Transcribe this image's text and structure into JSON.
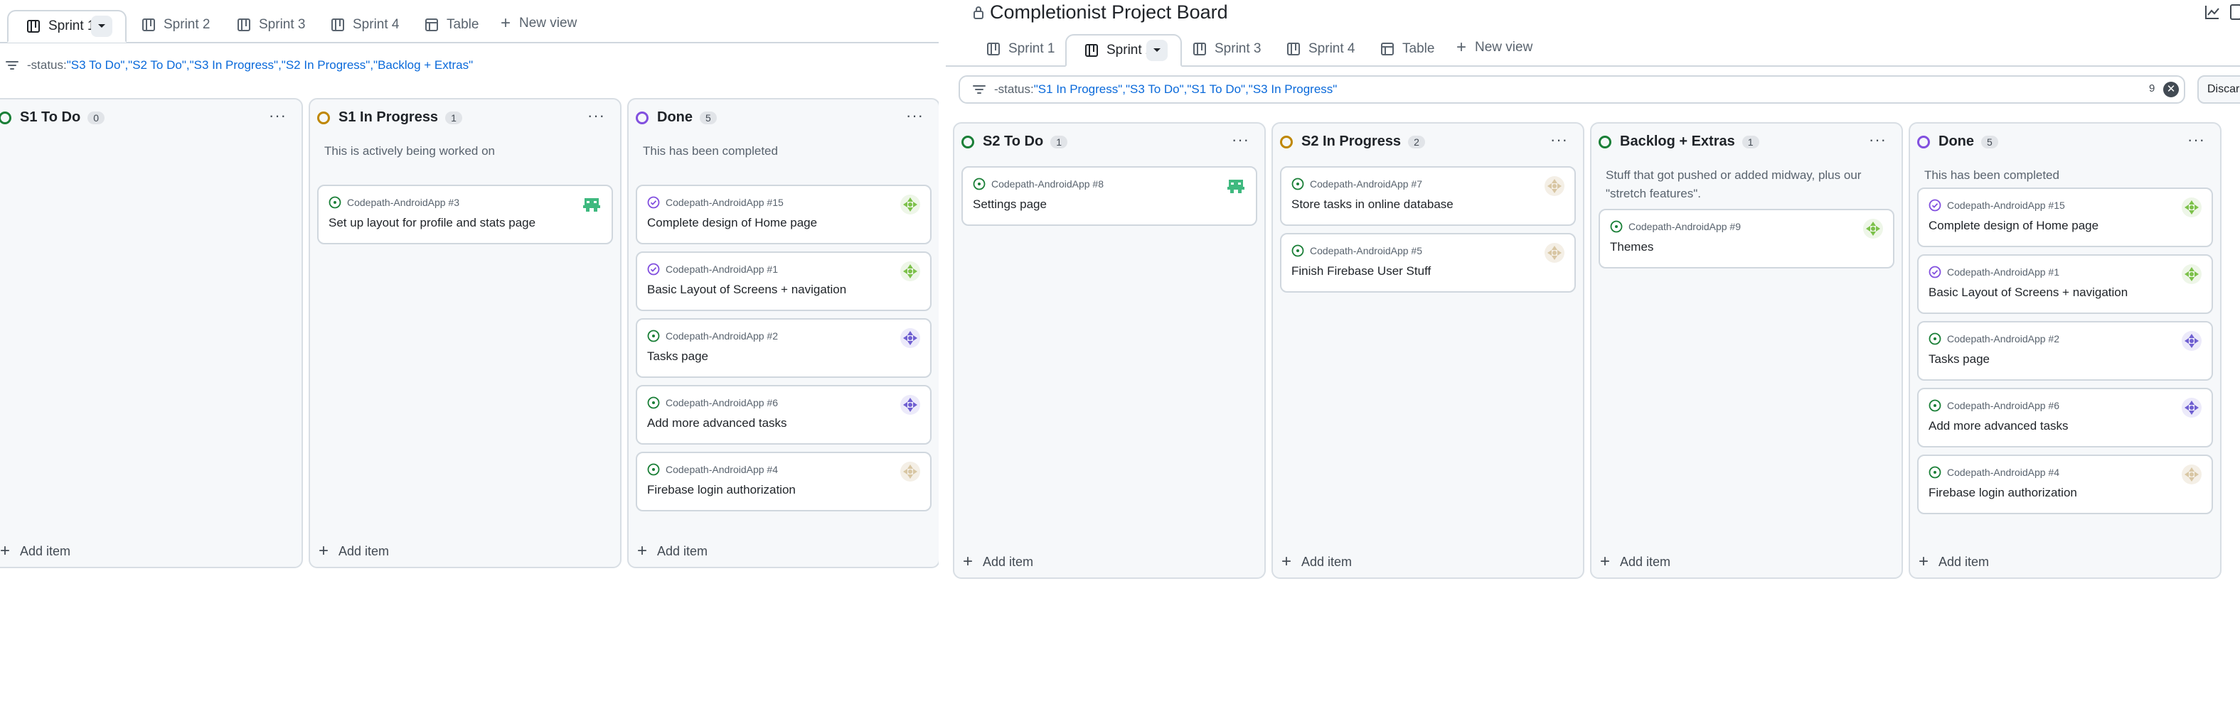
{
  "left_pane": {
    "tabs": [
      {
        "label": "Sprint 1",
        "active": true
      },
      {
        "label": "Sprint 2"
      },
      {
        "label": "Sprint 3"
      },
      {
        "label": "Sprint 4"
      },
      {
        "label": "Table"
      },
      {
        "label": "New view"
      }
    ],
    "filter": {
      "label": "-status:",
      "value": "\"S3 To Do\",\"S2 To Do\",\"S3 In Progress\",\"S2 In Progress\",\"Backlog + Extras\""
    },
    "columns": [
      {
        "name": "S1 To Do",
        "count": "0",
        "color": "#1a7f37",
        "description": "",
        "cards": []
      },
      {
        "name": "S1 In Progress",
        "count": "1",
        "color": "#bf8700",
        "description": "This is actively being worked on",
        "cards": [
          {
            "repo": "Codepath-AndroidApp #3",
            "title": "Set up layout for profile and stats page",
            "state": "open",
            "avatar": "green-robot"
          }
        ]
      },
      {
        "name": "Done",
        "count": "5",
        "color": "#8250df",
        "description": "This has been completed",
        "cards": [
          {
            "repo": "Codepath-AndroidApp #15",
            "title": "Complete design of Home page",
            "state": "closed",
            "avatar": "green-pattern"
          },
          {
            "repo": "Codepath-AndroidApp #1",
            "title": "Basic Layout of Screens + navigation",
            "state": "closed",
            "avatar": "green-pattern"
          },
          {
            "repo": "Codepath-AndroidApp #2",
            "title": "Tasks page",
            "state": "open",
            "avatar": "purple-pattern"
          },
          {
            "repo": "Codepath-AndroidApp #6",
            "title": "Add more advanced tasks",
            "state": "open",
            "avatar": "purple-pattern"
          },
          {
            "repo": "Codepath-AndroidApp #4",
            "title": "Firebase login authorization",
            "state": "open",
            "avatar": "beige-pattern"
          }
        ]
      }
    ],
    "add_item_label": "Add item"
  },
  "right_pane": {
    "title": "Completionist Project Board",
    "tabs": [
      {
        "label": "Sprint 1"
      },
      {
        "label": "Sprint 2",
        "active": true
      },
      {
        "label": "Sprint 3"
      },
      {
        "label": "Sprint 4"
      },
      {
        "label": "Table"
      },
      {
        "label": "New view"
      }
    ],
    "filter": {
      "label": "-status:",
      "value": "\"S1 In Progress\",\"S3 To Do\",\"S1 To Do\",\"S3 In Progress\"",
      "match_count": "9"
    },
    "discard_label": "Discar",
    "columns": [
      {
        "name": "S2 To Do",
        "count": "1",
        "color": "#1a7f37",
        "description": "",
        "cards": [
          {
            "repo": "Codepath-AndroidApp #8",
            "title": "Settings page",
            "state": "open",
            "avatar": "green-robot"
          }
        ]
      },
      {
        "name": "S2 In Progress",
        "count": "2",
        "color": "#bf8700",
        "description": "",
        "cards": [
          {
            "repo": "Codepath-AndroidApp #7",
            "title": "Store tasks in online database",
            "state": "open",
            "avatar": "beige-pattern"
          },
          {
            "repo": "Codepath-AndroidApp #5",
            "title": "Finish Firebase User Stuff",
            "state": "open",
            "avatar": "beige-pattern"
          }
        ]
      },
      {
        "name": "Backlog + Extras",
        "count": "1",
        "color": "#1a7f37",
        "description": "Stuff that got pushed or added midway, plus our \"stretch features\".",
        "cards": [
          {
            "repo": "Codepath-AndroidApp #9",
            "title": "Themes",
            "state": "open",
            "avatar": "green-pattern"
          }
        ]
      },
      {
        "name": "Done",
        "count": "5",
        "color": "#8250df",
        "description": "This has been completed",
        "cards": [
          {
            "repo": "Codepath-AndroidApp #15",
            "title": "Complete design of Home page",
            "state": "closed",
            "avatar": "green-pattern"
          },
          {
            "repo": "Codepath-AndroidApp #1",
            "title": "Basic Layout of Screens + navigation",
            "state": "closed",
            "avatar": "green-pattern"
          },
          {
            "repo": "Codepath-AndroidApp #2",
            "title": "Tasks page",
            "state": "open",
            "avatar": "purple-pattern"
          },
          {
            "repo": "Codepath-AndroidApp #6",
            "title": "Add more advanced tasks",
            "state": "open",
            "avatar": "purple-pattern"
          },
          {
            "repo": "Codepath-AndroidApp #4",
            "title": "Firebase login authorization",
            "state": "open",
            "avatar": "beige-pattern"
          }
        ]
      }
    ],
    "add_item_label": "Add item"
  },
  "colors": {
    "open": "#1a7f37",
    "closed": "#8250df",
    "link": "#0969da",
    "column_bg": "#f6f8fa"
  }
}
